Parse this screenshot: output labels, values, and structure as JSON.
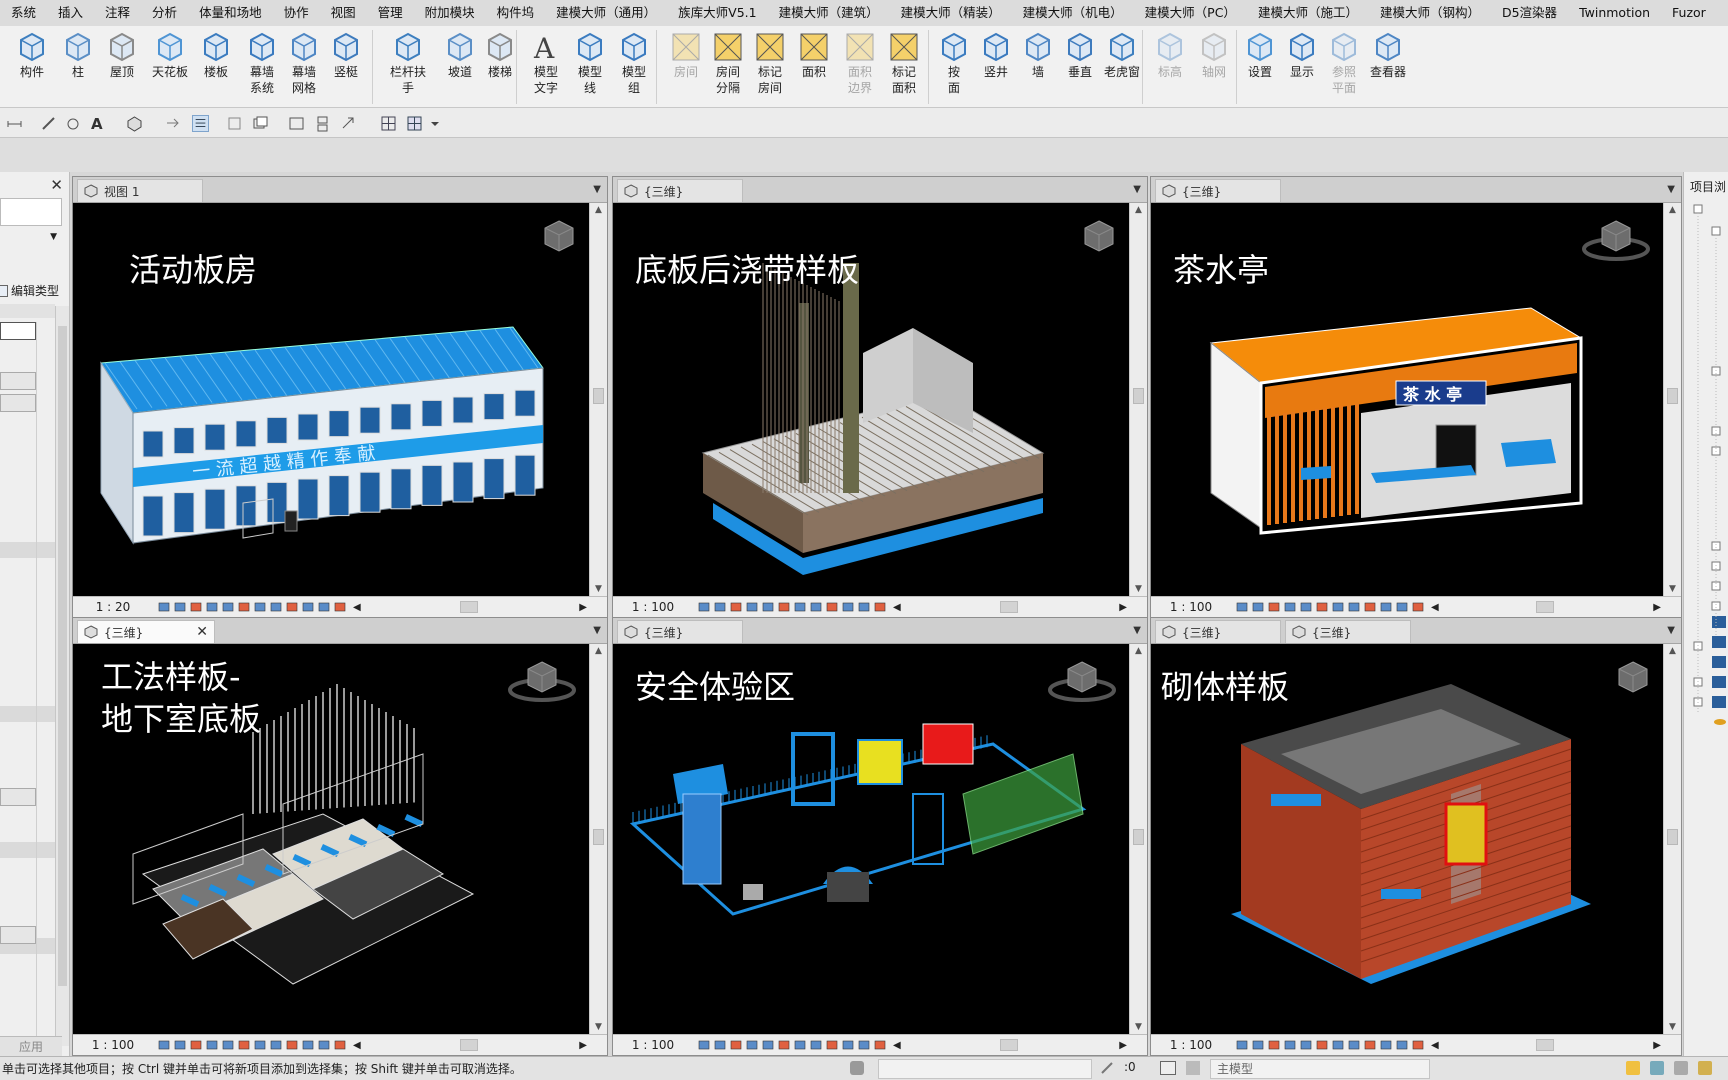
{
  "menu": [
    "系统",
    "插入",
    "注释",
    "分析",
    "体量和场地",
    "协作",
    "视图",
    "管理",
    "附加模块",
    "构件坞",
    "建模大师（通用）",
    "族库大师V5.1",
    "建模大师（建筑）",
    "建模大师（精装）",
    "建模大师（机电）",
    "建模大师（PC）",
    "建模大师（施工）",
    "建模大师（钢构）",
    "D5渲染器",
    "Twinmotion",
    "Fuzor"
  ],
  "ribbon": {
    "buttons": [
      {
        "label": "构件",
        "icon": "component-icon"
      },
      {
        "label": "柱",
        "icon": "column-icon"
      },
      {
        "label": "屋顶",
        "icon": "roof-icon"
      },
      {
        "label": "天花板",
        "icon": "ceiling-icon"
      },
      {
        "label": "楼板",
        "icon": "floor-icon"
      },
      {
        "label": "幕墙\n系统",
        "icon": "curtain-system-icon"
      },
      {
        "label": "幕墙\n网格",
        "icon": "curtain-grid-icon"
      },
      {
        "label": "竖梃",
        "icon": "mullion-icon"
      },
      {
        "label": "栏杆扶手",
        "icon": "railing-icon"
      },
      {
        "label": "坡道",
        "icon": "ramp-icon"
      },
      {
        "label": "楼梯",
        "icon": "stair-icon"
      },
      {
        "label": "模型\n文字",
        "icon": "model-text-icon"
      },
      {
        "label": "模型\n线",
        "icon": "model-line-icon"
      },
      {
        "label": "模型\n组",
        "icon": "model-group-icon"
      },
      {
        "label": "房间",
        "icon": "room-icon"
      },
      {
        "label": "房间\n分隔",
        "icon": "room-separator-icon"
      },
      {
        "label": "标记\n房间",
        "icon": "tag-room-icon"
      },
      {
        "label": "面积",
        "icon": "area-icon"
      },
      {
        "label": "面积\n边界",
        "icon": "area-boundary-icon"
      },
      {
        "label": "标记\n面积",
        "icon": "tag-area-icon"
      },
      {
        "label": "按\n面",
        "icon": "by-face-icon"
      },
      {
        "label": "竖井",
        "icon": "shaft-icon"
      },
      {
        "label": "墙",
        "icon": "wall-opening-icon"
      },
      {
        "label": "垂直",
        "icon": "vertical-opening-icon"
      },
      {
        "label": "老虎窗",
        "icon": "dormer-icon"
      },
      {
        "label": "标高",
        "icon": "level-icon"
      },
      {
        "label": "轴网",
        "icon": "grid-icon"
      },
      {
        "label": "设置",
        "icon": "workplane-set-icon"
      },
      {
        "label": "显示",
        "icon": "workplane-show-icon"
      },
      {
        "label": "参照\n平面",
        "icon": "ref-plane-icon"
      },
      {
        "label": "查看器",
        "icon": "viewer-icon"
      }
    ]
  },
  "left_panel": {
    "edit_type": "编辑类型",
    "apply": "应用"
  },
  "right_panel": {
    "title": "项目浏"
  },
  "viewports": [
    {
      "tab": "视图 1",
      "title": "活动板房",
      "scale": "1 : 20",
      "active": false
    },
    {
      "tab": "{三维}",
      "title": "底板后浇带样板",
      "scale": "1 : 100",
      "active": false
    },
    {
      "tab": "{三维}",
      "title": "茶水亭",
      "scale": "1 : 100",
      "active": false
    },
    {
      "tab": "{三维}",
      "title": "工法样板-\n地下室底板",
      "scale": "1 : 100",
      "active": true
    },
    {
      "tab": "{三维}",
      "title": "安全体验区",
      "scale": "1 : 100",
      "active": false
    },
    {
      "tab": "{三维}",
      "tab2": "{三维}",
      "title": "砌体样板",
      "scale": "1 : 100",
      "active": false
    }
  ],
  "scene_text": {
    "banner": "一 流  超 越  精 作  奉 献",
    "tea_sign": "茶 水 亭"
  },
  "statusbar": {
    "hint": "单击可选择其他项目；按 Ctrl 键并单击可将新项目添加到选择集；按 Shift 键并单击可取消选择。",
    "filter_count": ":0",
    "model": "主模型"
  }
}
